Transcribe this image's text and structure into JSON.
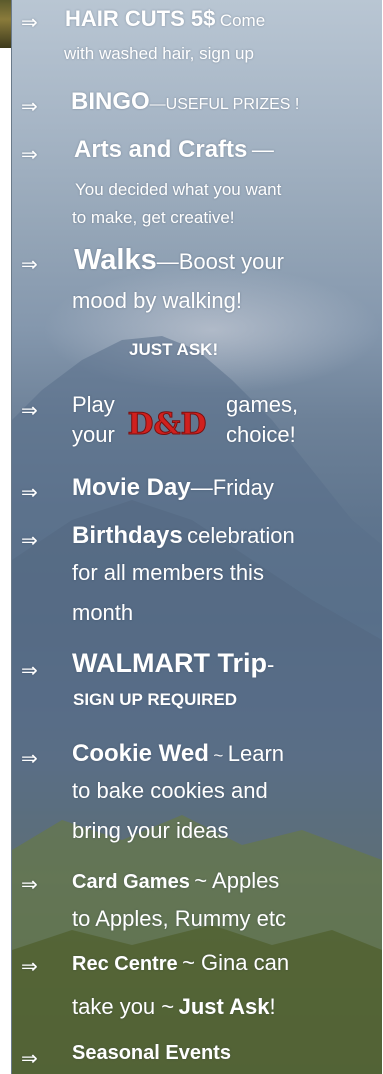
{
  "arrow_glyph": "⇒",
  "items": [
    {
      "title": "HAIR CUTS 5$",
      "text1": "Come",
      "text2": "with washed hair, sign up"
    },
    {
      "title": "BINGO",
      "text1": "—USEFUL PRIZES !"
    },
    {
      "title": "Arts and Crafts",
      "text1": "—",
      "text2": "You decided what you want",
      "text3": "to make, get creative!"
    },
    {
      "title": "Walks",
      "text1": "—Boost your",
      "text2": "mood by walking!",
      "text3": "JUST ASK!"
    },
    {
      "text1": "Play",
      "text2": "games,",
      "text3": "your",
      "text4": "choice!"
    },
    {
      "title": "Movie Day",
      "text1": "—Friday"
    },
    {
      "title": "Birthdays",
      "text1": "celebration",
      "text2": "for all members this",
      "text3": "month"
    },
    {
      "title": "WALMART Trip",
      "text1": "-",
      "text2": "SIGN UP REQUIRED"
    },
    {
      "title": "Cookie Wed",
      "text1": "~",
      "text2": "Learn",
      "text3": "to bake cookies and",
      "text4": "bring your ideas"
    },
    {
      "title": "Card Games",
      "text1": "~ Apples",
      "text2": "to Apples, Rummy etc"
    },
    {
      "title": "Rec Centre",
      "text1": "~ Gina can",
      "text2": "take you ~",
      "text3": "Just Ask",
      "text4": "!"
    },
    {
      "title": "Seasonal Events"
    }
  ],
  "logo": {
    "name": "dnd-logo",
    "text": "D&D",
    "color": "#d0201e"
  },
  "colors": {
    "text": "#ffffff",
    "sky": "#b9c6d3",
    "mountain": "#5f758e",
    "forest": "#5f6e32"
  }
}
